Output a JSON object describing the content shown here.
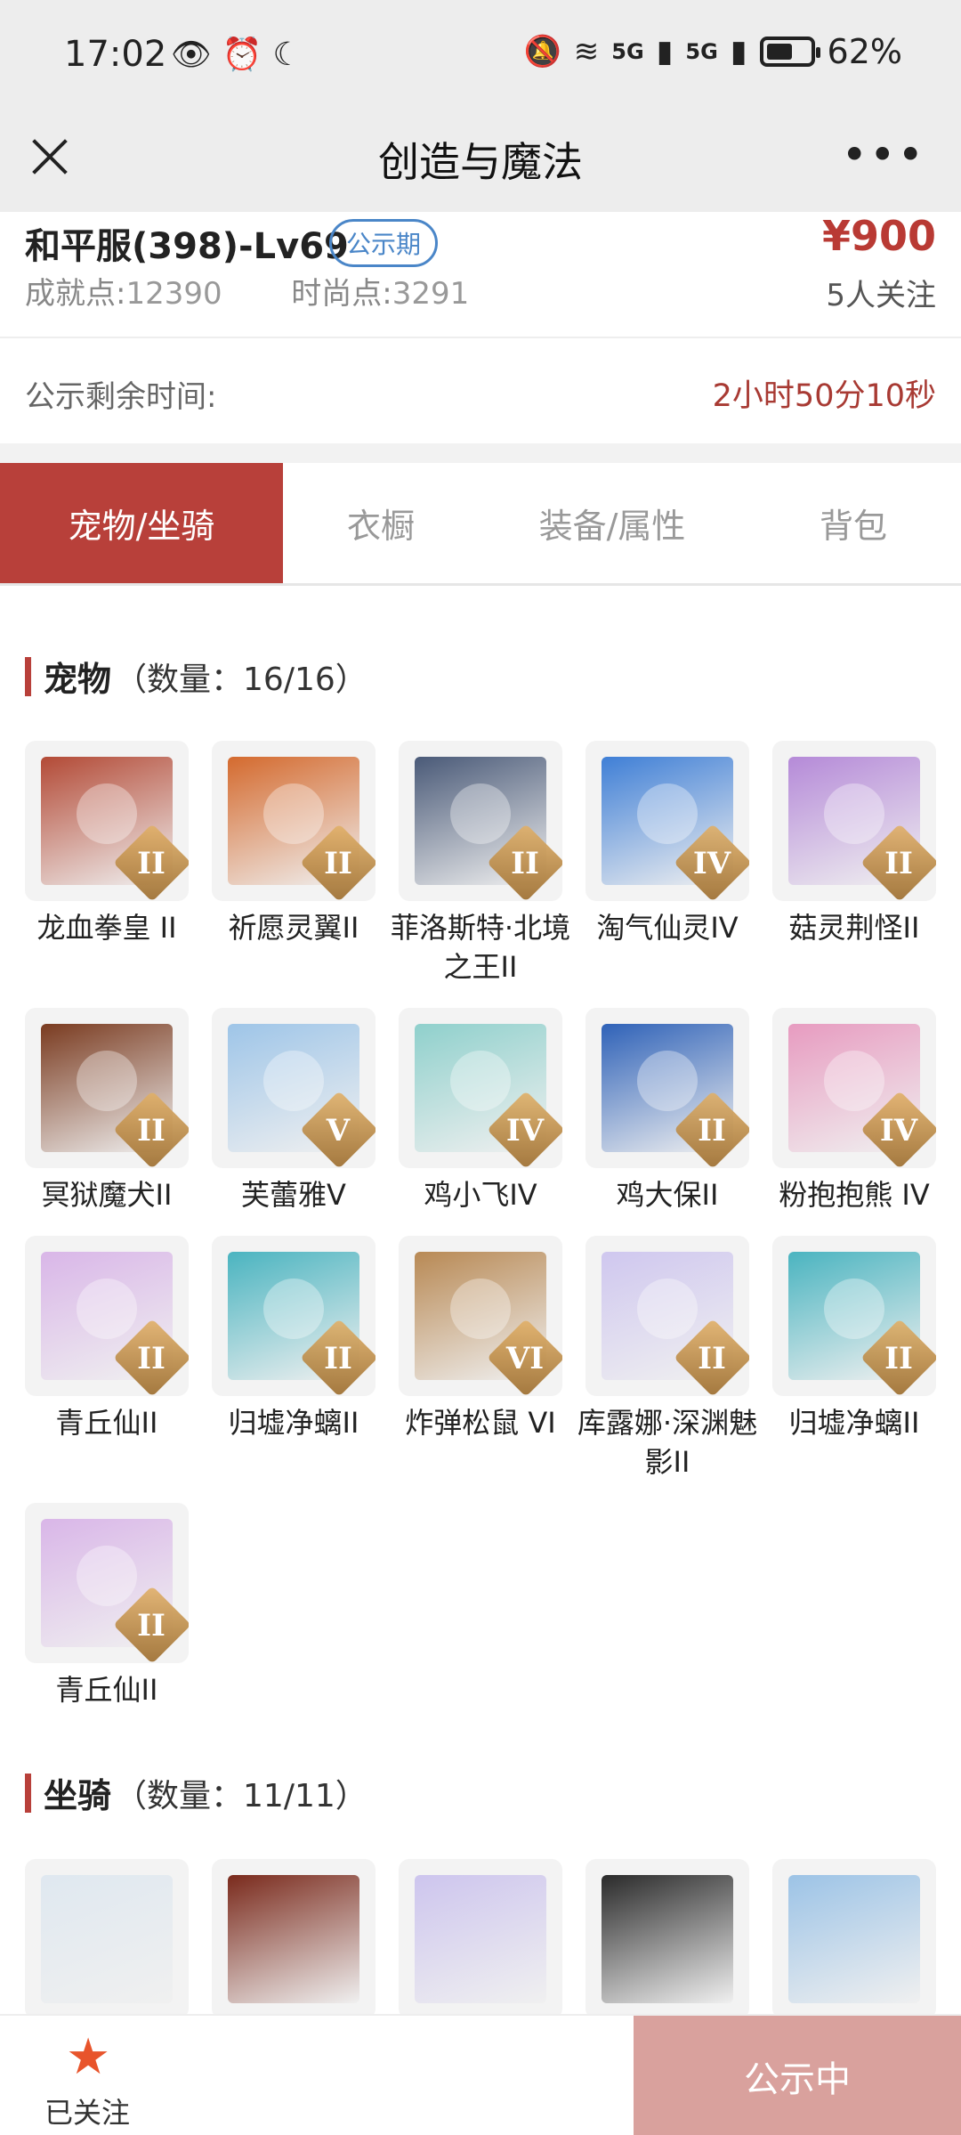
{
  "status_bar": {
    "time": "17:02",
    "battery": "62%",
    "battery_level": 0.62,
    "signal1": "5G",
    "signal2": "5G"
  },
  "nav": {
    "title": "创造与魔法"
  },
  "listing": {
    "server": "和平服(398)-Lv69",
    "badge": "公示期",
    "price": "¥900",
    "achievement_label": "成就点:",
    "achievement_value": "12390",
    "fashion_label": "时尚点:",
    "fashion_value": "3291",
    "followers": "5人关注"
  },
  "remaining": {
    "label": "公示剩余时间:",
    "value": "2小时50分10秒"
  },
  "tabs": [
    {
      "label": "宠物/坐骑",
      "active": true
    },
    {
      "label": "衣橱",
      "active": false
    },
    {
      "label": "装备/属性",
      "active": false
    },
    {
      "label": "背包",
      "active": false
    }
  ],
  "pets_section": {
    "title": "宠物",
    "count": "（数量：16/16）",
    "items": [
      {
        "name": "龙血拳皇 II",
        "rank": "II",
        "color": "#b34a36"
      },
      {
        "name": "祈愿灵翼II",
        "rank": "II",
        "color": "#d46a2e"
      },
      {
        "name": "菲洛斯特·北境之王II",
        "rank": "II",
        "color": "#4a5a78"
      },
      {
        "name": "淘气仙灵IV",
        "rank": "IV",
        "color": "#3f7fd6"
      },
      {
        "name": "菇灵荆怪II",
        "rank": "II",
        "color": "#b58ad8"
      },
      {
        "name": "冥狱魔犬II",
        "rank": "II",
        "color": "#7a3b20"
      },
      {
        "name": "芙蕾雅V",
        "rank": "V",
        "color": "#9ec5e8"
      },
      {
        "name": "鸡小飞IV",
        "rank": "IV",
        "color": "#8fd0cc"
      },
      {
        "name": "鸡大保II",
        "rank": "II",
        "color": "#2f62b8"
      },
      {
        "name": "粉抱抱熊 IV",
        "rank": "IV",
        "color": "#e79bc0"
      },
      {
        "name": "青丘仙II",
        "rank": "II",
        "color": "#d9b6e8"
      },
      {
        "name": "归墟净螭II",
        "rank": "II",
        "color": "#4ab4c0"
      },
      {
        "name": "炸弹松鼠 VI",
        "rank": "VI",
        "color": "#b88954"
      },
      {
        "name": "库露娜·深渊魅影II",
        "rank": "II",
        "color": "#cfc7ef"
      },
      {
        "name": "归墟净螭II",
        "rank": "II",
        "color": "#4ab4c0"
      },
      {
        "name": "青丘仙II",
        "rank": "II",
        "color": "#d9b6e8"
      }
    ]
  },
  "mounts_section": {
    "title": "坐骑",
    "count": "（数量：11/11）",
    "items": [
      {
        "color": "#dfe8f0"
      },
      {
        "color": "#7a2a1c"
      },
      {
        "color": "#cdc5ee"
      },
      {
        "color": "#2a2a2a"
      },
      {
        "color": "#9cc3e6"
      }
    ]
  },
  "bottom": {
    "follow_label": "已关注",
    "action_label": "公示中"
  }
}
